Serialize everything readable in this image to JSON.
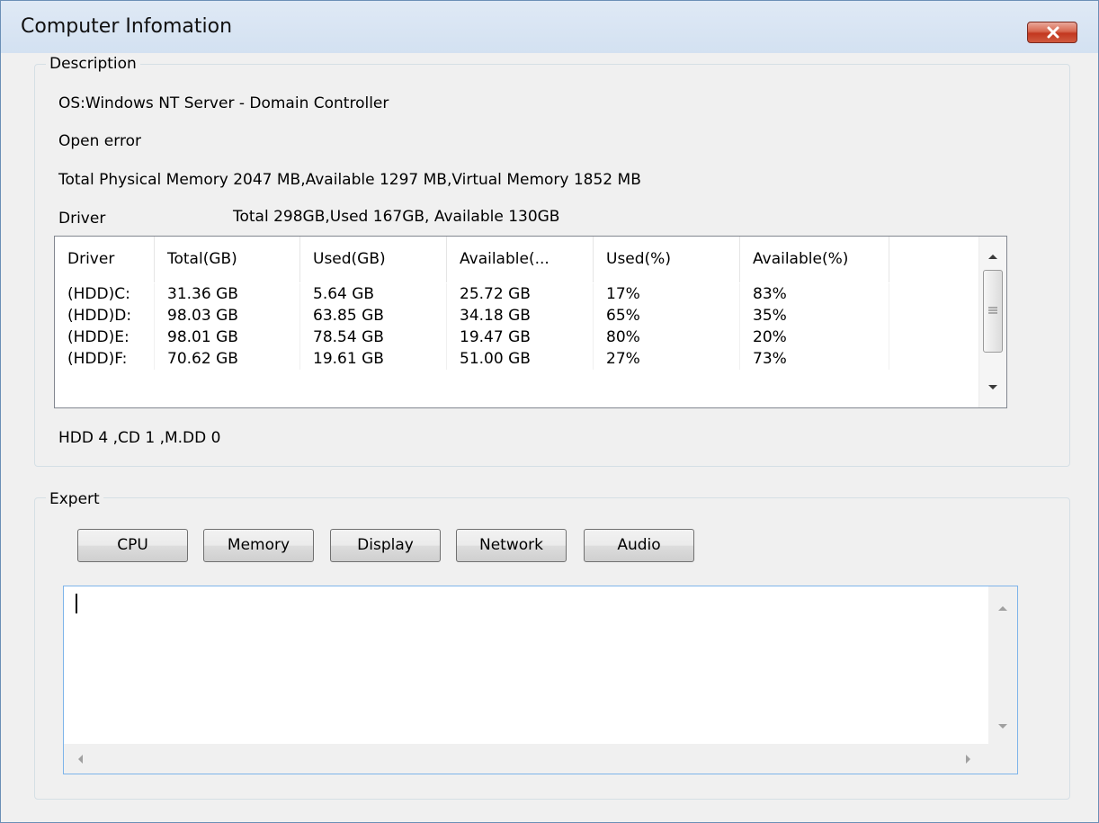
{
  "window": {
    "title": "Computer Infomation"
  },
  "description": {
    "legend": "Description",
    "os": "OS:Windows NT Server - Domain Controller",
    "status": "Open error",
    "memory": "Total Physical Memory 2047 MB,Available 1297 MB,Virtual Memory 1852 MB",
    "driver_label": "Driver",
    "driver_summary": "Total 298GB,Used 167GB, Available 130GB",
    "table": {
      "columns": [
        "Driver",
        "Total(GB)",
        "Used(GB)",
        "Available(...",
        "Used(%)",
        "Available(%)",
        ""
      ],
      "rows": [
        [
          "(HDD)C:",
          "31.36 GB",
          "5.64 GB",
          "25.72 GB",
          "17%",
          "83%",
          ""
        ],
        [
          "(HDD)D:",
          "98.03 GB",
          "63.85 GB",
          "34.18 GB",
          "65%",
          "35%",
          ""
        ],
        [
          "(HDD)E:",
          "98.01 GB",
          "78.54 GB",
          "19.47 GB",
          "80%",
          "20%",
          ""
        ],
        [
          "(HDD)F:",
          "70.62 GB",
          "19.61 GB",
          "51.00 GB",
          "27%",
          "73%",
          ""
        ]
      ]
    },
    "device_counts": "HDD 4 ,CD 1 ,M.DD 0"
  },
  "expert": {
    "legend": "Expert",
    "buttons": [
      "CPU",
      "Memory",
      "Display",
      "Network",
      "Audio"
    ],
    "output_text": ""
  },
  "colors": {
    "close_button": "#c2371f",
    "title_bar": "#d3e1f1",
    "textarea_border": "#7eb4ea"
  }
}
